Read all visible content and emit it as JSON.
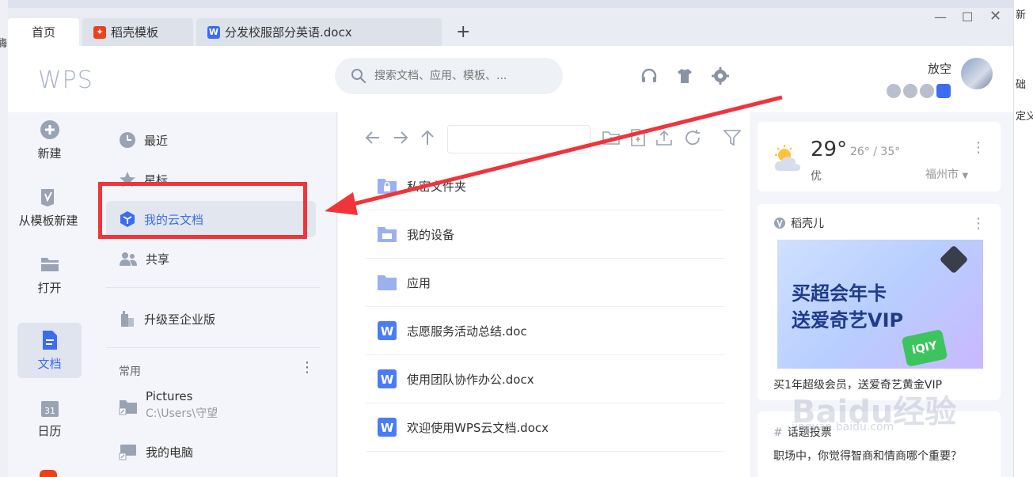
{
  "tabs": [
    {
      "label": "首页",
      "active": true
    },
    {
      "label": "稻壳模板",
      "icon": "daoke-icon",
      "color": "#e8431f"
    },
    {
      "label": "分发校服部分英语.docx",
      "icon": "word-doc-icon",
      "color": "#3c6cf0"
    }
  ],
  "header": {
    "logo": "WPS",
    "search_placeholder": "搜索文档、应用、模板、...",
    "username": "放空"
  },
  "leftnav": [
    {
      "label": "新建",
      "icon": "plus-circle-icon"
    },
    {
      "label": "从模板新建",
      "icon": "template-icon"
    },
    {
      "label": "打开",
      "icon": "folder-open-icon"
    },
    {
      "label": "文档",
      "icon": "document-icon",
      "active": true
    },
    {
      "label": "日历",
      "icon": "calendar-icon",
      "day": "31"
    }
  ],
  "sidebar": {
    "items": [
      {
        "label": "最近",
        "icon": "clock-icon"
      },
      {
        "label": "星标",
        "icon": "star-icon"
      },
      {
        "label": "我的云文档",
        "icon": "cloud-doc-icon",
        "active": true
      },
      {
        "label": "共享",
        "icon": "share-icon"
      },
      {
        "label": "升级至企业版",
        "icon": "enterprise-icon"
      }
    ],
    "section": "常用",
    "pictures": {
      "name": "Pictures",
      "path": "C:\\Users\\守望"
    },
    "my_computer": "我的电脑"
  },
  "files": [
    {
      "name": "私密文件夹",
      "type": "private-folder"
    },
    {
      "name": "我的设备",
      "type": "device-folder"
    },
    {
      "name": "应用",
      "type": "folder"
    },
    {
      "name": "志愿服务活动总结.doc",
      "type": "doc"
    },
    {
      "name": "使用团队协作办公.docx",
      "type": "doc"
    },
    {
      "name": "欢迎使用WPS云文档.docx",
      "type": "doc"
    }
  ],
  "weather": {
    "temp": "29°",
    "range": "26° / 35°",
    "condition": "优",
    "city": "福州市"
  },
  "promo": {
    "title": "稻壳儿",
    "line1": "买超会年卡",
    "line2": "送爱奇艺VIP",
    "caption": "买1年超级会员，送爱奇艺黄金VIP"
  },
  "topic": {
    "title": "话题投票",
    "question": "职场中，你觉得智商和情商哪个重要？"
  },
  "background": {
    "left_char": "酶",
    "right_chars": [
      "新",
      "础",
      "定义"
    ]
  },
  "watermark": {
    "main": "Baidu经验",
    "sub": "jingyan.baidu.com"
  },
  "colors": {
    "accent": "#3c6cf0",
    "annotation": "#f0343a"
  }
}
